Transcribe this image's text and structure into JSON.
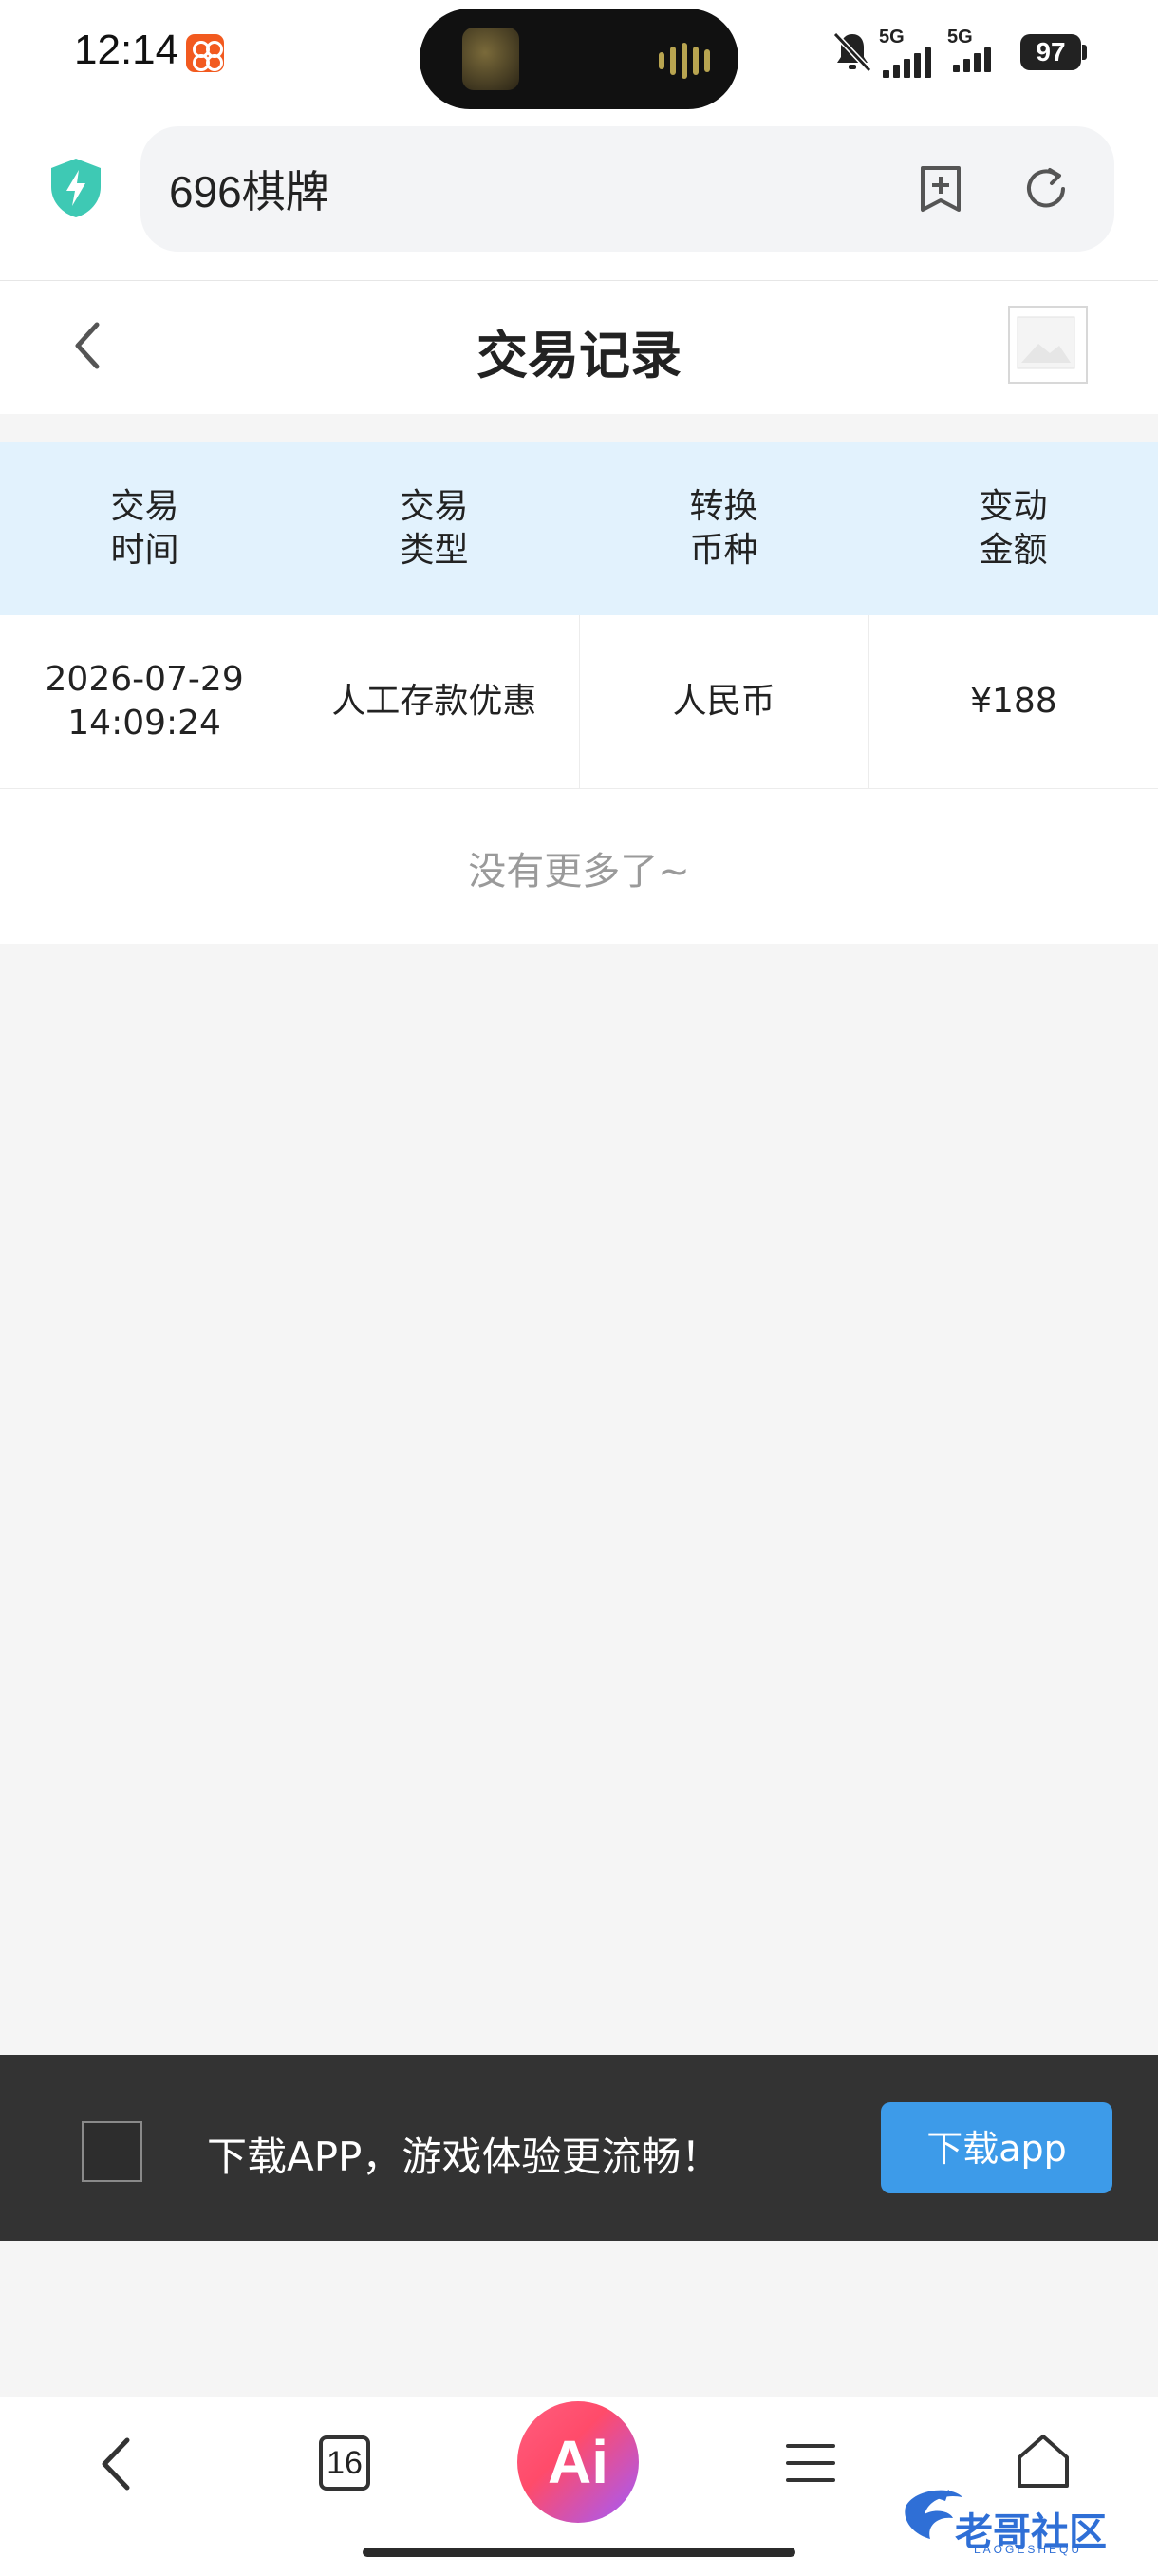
{
  "status_bar": {
    "time": "12:14",
    "network_1": "5G",
    "network_2": "5G",
    "battery": "97"
  },
  "browser": {
    "url_text": "696棋牌"
  },
  "page": {
    "title": "交易记录"
  },
  "table": {
    "headers": [
      {
        "line1": "交易",
        "line2": "时间"
      },
      {
        "line1": "交易",
        "line2": "类型"
      },
      {
        "line1": "转换",
        "line2": "币种"
      },
      {
        "line1": "变动",
        "line2": "金额"
      }
    ],
    "rows": [
      {
        "date": "2026-07-29",
        "time": "14:09:24",
        "type": "人工存款优惠",
        "currency": "人民币",
        "amount": "¥188"
      }
    ],
    "footer_text": "没有更多了~"
  },
  "download_banner": {
    "text": "下载APP，游戏体验更流畅！",
    "button_label": "下载app"
  },
  "bottom_nav": {
    "tab_count": "16",
    "ai_label": "Ai"
  },
  "watermark": {
    "text": "老哥社区",
    "subtext": "LAOGESHEQU"
  },
  "icons": {
    "shield": "shield-bolt-icon",
    "bookmark": "bookmark-add-icon",
    "reload": "reload-icon",
    "back": "chevron-left-icon",
    "menu": "menu-icon",
    "home": "home-icon"
  },
  "colors": {
    "table_header_bg": "#e2f2fd",
    "download_button": "#3d9be9",
    "banner_bg": "#333333",
    "shield": "#3ec9b4"
  }
}
